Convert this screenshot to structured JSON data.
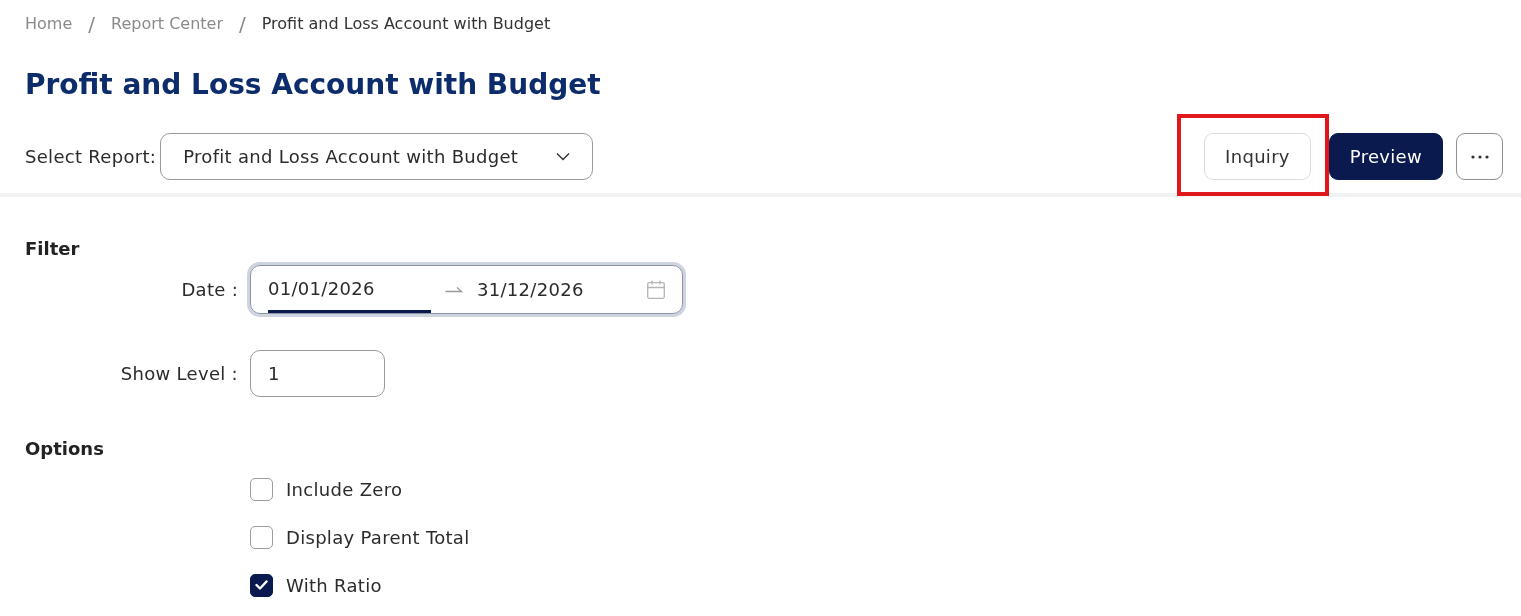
{
  "breadcrumb": [
    {
      "label": "Home",
      "current": false
    },
    {
      "separator": "/",
      "label": "Report Center",
      "current": false
    },
    {
      "separator": "/",
      "label": "Profit and Loss Account with Budget",
      "current": true
    }
  ],
  "title": "Profit and Loss Account with Budget",
  "report_selector": {
    "label": "Select Report:",
    "value": "Profit and Loss Account with Budget"
  },
  "actions": [
    {
      "kind": "outline",
      "label": "Inquiry",
      "highlighted": true
    },
    {
      "kind": "primary",
      "label": "Preview",
      "highlighted": false
    },
    {
      "kind": "more",
      "highlighted": false
    }
  ],
  "filter": {
    "heading": "Filter",
    "date": {
      "label": "Date :",
      "start": "01/01/2026",
      "end": "31/12/2026",
      "focused": true
    },
    "show_level": {
      "label": "Show Level :",
      "value": "1"
    }
  },
  "options": {
    "heading": "Options",
    "items": [
      {
        "label": "Include Zero",
        "checked": false
      },
      {
        "label": "Display Parent Total",
        "checked": false
      },
      {
        "label": "With Ratio",
        "checked": true
      }
    ]
  }
}
